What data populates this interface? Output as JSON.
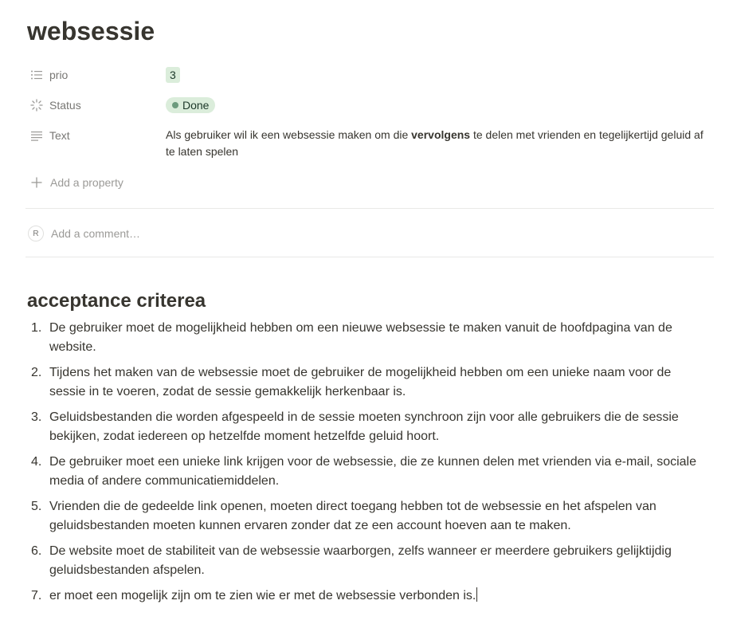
{
  "page": {
    "title": "websessie"
  },
  "properties": {
    "prio": {
      "label": "prio",
      "value": "3",
      "icon": "list-icon"
    },
    "status": {
      "label": "Status",
      "value": "Done",
      "icon": "status-spinner-icon",
      "color": "#dbeddb",
      "dot_color": "#6c9b7d"
    },
    "text": {
      "label": "Text",
      "icon": "text-lines-icon",
      "value_before": "Als gebruiker wil ik een websessie maken om die ",
      "value_bold": "vervolgens",
      "value_after": " te delen met vrienden en tegelijkertijd geluid af te laten spelen"
    },
    "add_property_label": "Add a property"
  },
  "comment": {
    "avatar_initial": "R",
    "placeholder": "Add a comment…"
  },
  "section": {
    "heading": "acceptance criterea",
    "items": [
      {
        "num": "1.",
        "text": "De gebruiker moet de mogelijkheid hebben om een nieuwe websessie te maken vanuit de hoofdpagina van de website."
      },
      {
        "num": "2.",
        "text": "Tijdens het maken van de websessie moet de gebruiker de mogelijkheid hebben om een unieke naam voor de sessie in te voeren, zodat de sessie gemakkelijk herkenbaar is."
      },
      {
        "num": "3.",
        "text": "Geluidsbestanden die worden afgespeeld in de sessie moeten synchroon zijn voor alle gebruikers die de sessie bekijken, zodat iedereen op hetzelfde moment hetzelfde geluid hoort."
      },
      {
        "num": "4.",
        "text": "De gebruiker moet een unieke link krijgen voor de websessie, die ze kunnen delen met vrienden via e-mail, sociale media of andere communicatiemiddelen."
      },
      {
        "num": "5.",
        "text": "Vrienden die de gedeelde link openen, moeten direct toegang hebben tot de websessie en het afspelen van geluidsbestanden moeten kunnen ervaren zonder dat ze een account hoeven aan te maken."
      },
      {
        "num": "6.",
        "text": "De website moet de stabiliteit van de websessie waarborgen, zelfs wanneer er meerdere gebruikers gelijktijdig geluidsbestanden afspelen."
      },
      {
        "num": "7.",
        "text": "er moet een mogelijk zijn om te zien wie er met de websessie verbonden is."
      }
    ]
  }
}
